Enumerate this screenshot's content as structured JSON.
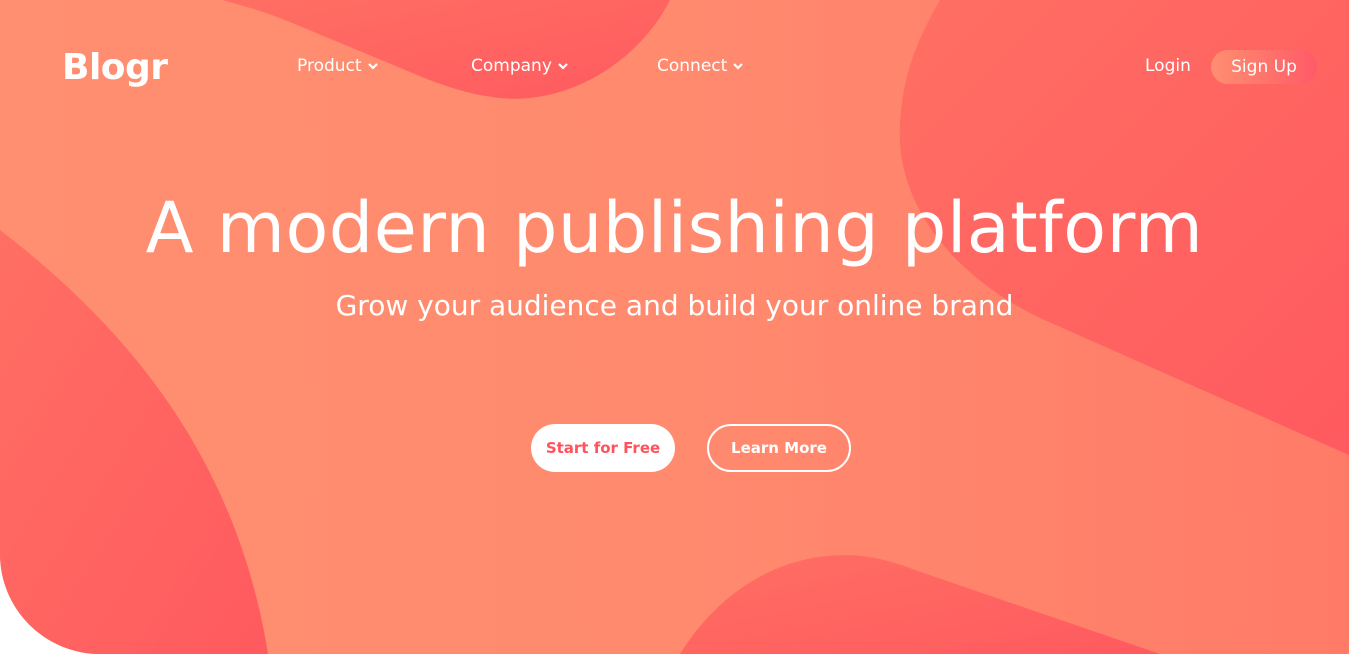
{
  "brand": {
    "name": "Blogr"
  },
  "nav": {
    "items": [
      {
        "label": "Product",
        "icon": "chevron-down-icon"
      },
      {
        "label": "Company",
        "icon": "chevron-down-icon"
      },
      {
        "label": "Connect",
        "icon": "chevron-down-icon"
      }
    ],
    "login_label": "Login",
    "signup_label": "Sign Up"
  },
  "hero": {
    "title": "A modern publishing platform",
    "subtitle": "Grow your audience and build your online brand",
    "primary_cta": "Start for Free",
    "secondary_cta": "Learn More"
  },
  "colors": {
    "background_gradient_start": "#ff8f70",
    "background_gradient_end": "#ff7b68",
    "blob": "#ff6562",
    "primary_button_text": "#ff525d",
    "text": "#ffffff"
  }
}
